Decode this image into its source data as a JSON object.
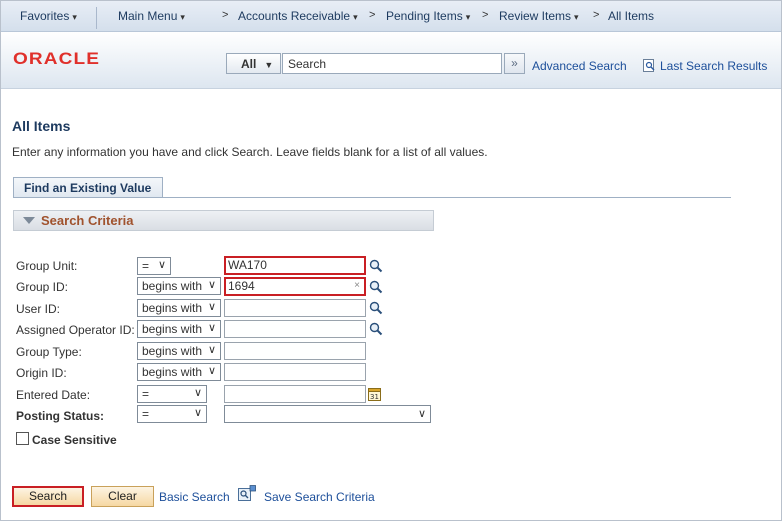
{
  "nav": {
    "favorites": "Favorites",
    "main_menu": "Main Menu",
    "accounts_receivable": "Accounts Receivable",
    "pending_items": "Pending Items",
    "review_items": "Review Items",
    "all_items": "All Items"
  },
  "header": {
    "logo": "ORACLE",
    "scope": "All",
    "search_value": "Search",
    "advanced_search": "Advanced Search",
    "last_search_results": "Last Search Results",
    "brand_color": "#e0302b"
  },
  "page": {
    "title": "All Items",
    "instructions": "Enter any information you have and click Search. Leave fields blank for a list of all values.",
    "tab": "Find an Existing Value",
    "criteria_header": "Search Criteria"
  },
  "fields": {
    "group_unit": {
      "label": "Group Unit:",
      "operator": "=",
      "value": "WA170"
    },
    "group_id": {
      "label": "Group ID:",
      "operator": "begins with",
      "value": "1694"
    },
    "user_id": {
      "label": "User ID:",
      "operator": "begins with",
      "value": ""
    },
    "assigned_operator_id": {
      "label": "Assigned Operator ID:",
      "operator": "begins with",
      "value": ""
    },
    "group_type": {
      "label": "Group Type:",
      "operator": "begins with",
      "value": ""
    },
    "origin_id": {
      "label": "Origin ID:",
      "operator": "begins with",
      "value": ""
    },
    "entered_date": {
      "label": "Entered Date:",
      "operator": "=",
      "value": ""
    },
    "posting_status": {
      "label": "Posting Status:",
      "operator": "=",
      "value": ""
    }
  },
  "case_sensitive": {
    "label": "Case Sensitive",
    "checked": false
  },
  "actions": {
    "search": "Search",
    "clear": "Clear",
    "basic_search": "Basic Search",
    "save_search_criteria": "Save Search Criteria"
  },
  "highlight_color": "#c91f24"
}
